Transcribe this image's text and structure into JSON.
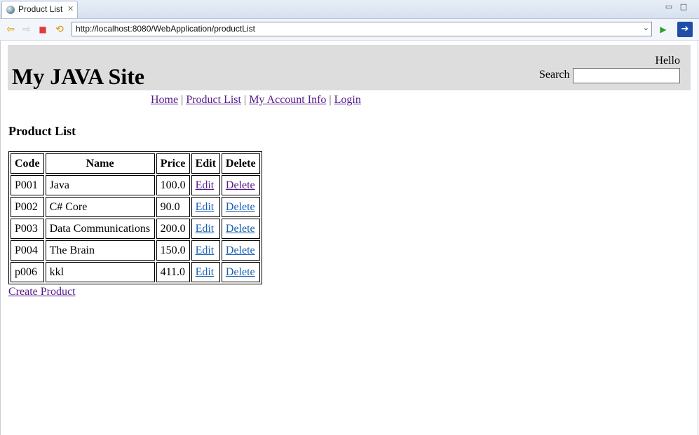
{
  "window": {
    "tab_title": "Product List",
    "tab_close_icon": "close-icon",
    "minimize_symbol": "▭",
    "maximize_symbol": "□"
  },
  "toolbar": {
    "back_icon": "⇦",
    "forward_icon": "⇨",
    "stop_icon": "■",
    "refresh_icon": "⟲",
    "url": "http://localhost:8080/WebApplication/productList",
    "dropdown_icon": "⌄",
    "go_icon": "▶",
    "external_icon": "➔"
  },
  "header": {
    "site_title": "My JAVA Site",
    "hello": "Hello",
    "search_label": "Search",
    "search_value": ""
  },
  "nav": [
    {
      "label": "Home",
      "visited": true
    },
    {
      "label": "Product List",
      "visited": true
    },
    {
      "label": "My Account Info",
      "visited": true
    },
    {
      "label": "Login",
      "visited": true
    }
  ],
  "nav_separator": "|",
  "page": {
    "heading": "Product List",
    "create_link": "Create Product"
  },
  "table": {
    "headers": [
      "Code",
      "Name",
      "Price",
      "Edit",
      "Delete"
    ],
    "rows": [
      {
        "code": "P001",
        "name": "Java",
        "price": "100.0",
        "edit": "Edit",
        "delete": "Delete",
        "visited": true
      },
      {
        "code": "P002",
        "name": "C# Core",
        "price": "90.0",
        "edit": "Edit",
        "delete": "Delete",
        "visited": false
      },
      {
        "code": "P003",
        "name": "Data Communications",
        "price": "200.0",
        "edit": "Edit",
        "delete": "Delete",
        "visited": false
      },
      {
        "code": "P004",
        "name": "The Brain",
        "price": "150.0",
        "edit": "Edit",
        "delete": "Delete",
        "visited": false
      },
      {
        "code": "p006",
        "name": "kkl",
        "price": "411.0",
        "edit": "Edit",
        "delete": "Delete",
        "visited": false
      }
    ]
  },
  "colors": {
    "header_bg": "#dddddd",
    "visited_link": "#551a8b",
    "unvisited_link": "#1a5fb4"
  }
}
